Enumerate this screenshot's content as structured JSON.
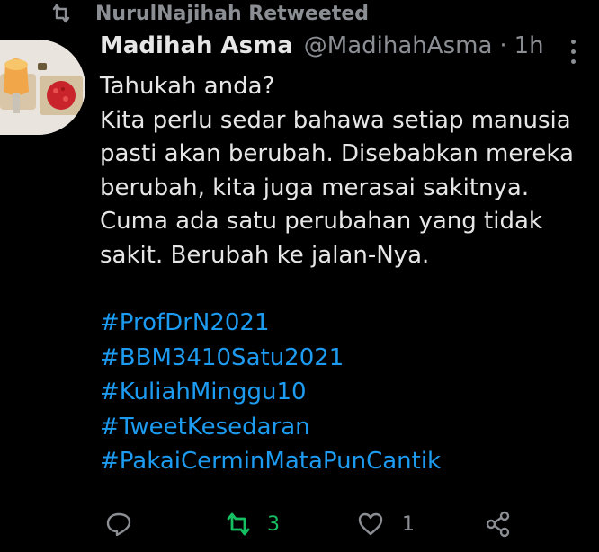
{
  "retweet_context": {
    "text": "NurulNajihah Retweeted"
  },
  "tweet": {
    "author_name": "Madihah Asma",
    "author_handle": "@MadihahAsma",
    "separator": "·",
    "time": "1h",
    "body_lines": [
      "Tahukah anda?",
      "Kita perlu sedar bahawa setiap manusia",
      "pasti akan berubah. Disebabkan mereka",
      "berubah, kita juga merasai sakitnya.",
      "Cuma ada satu perubahan yang tidak",
      "sakit. Berubah ke jalan-Nya."
    ],
    "hashtags": [
      "#ProfDrN2021",
      "#BBM3410Satu2021",
      "#KuliahMinggu10",
      "#TweetKesedaran",
      "#PakaiCerminMataPunCantik"
    ]
  },
  "actions": {
    "reply_count": "",
    "retweet_count": "3",
    "like_count": "1"
  },
  "colors": {
    "background": "#000000",
    "hashtag": "#1d9bf0",
    "retweeted": "#17bf63",
    "muted": "#8b8f94"
  },
  "icons": {
    "retweet_context": "retweet-icon",
    "more": "more-vertical-icon",
    "reply": "reply-icon",
    "retweet": "retweet-icon",
    "like": "heart-icon",
    "share": "share-icon"
  }
}
